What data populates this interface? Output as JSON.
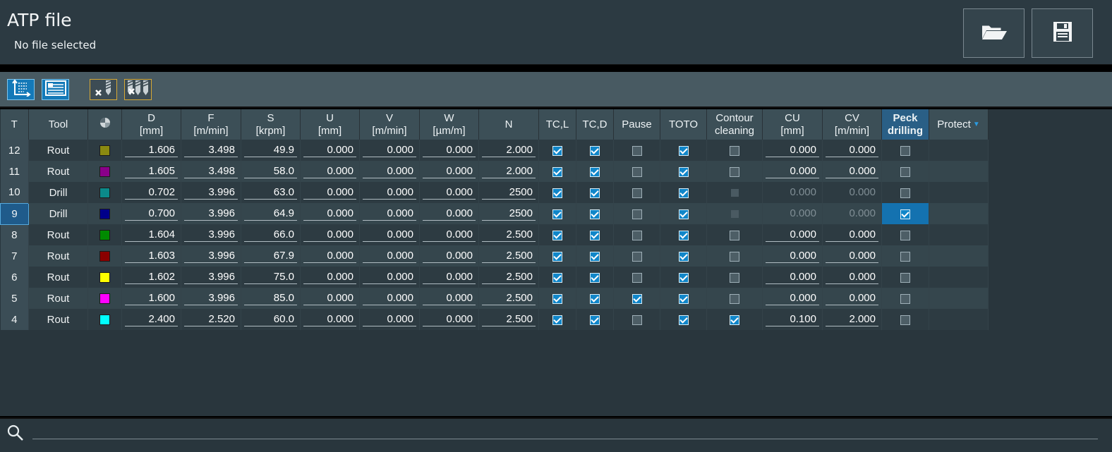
{
  "header": {
    "title": "ATP file",
    "subtitle": "No file selected"
  },
  "header_buttons": [
    {
      "name": "open-folder-button",
      "icon": "folder-open-icon"
    },
    {
      "name": "save-button",
      "icon": "floppy-disk-icon"
    }
  ],
  "toolbar": [
    {
      "name": "sort-axis-button",
      "icon": "axis-sort-icon"
    },
    {
      "name": "table-view-button",
      "icon": "table-view-icon"
    },
    {
      "name": "remove-tool-button",
      "icon": "remove-tool-icon"
    },
    {
      "name": "remove-all-tools-button",
      "icon": "remove-all-tools-icon"
    }
  ],
  "table": {
    "columns": [
      {
        "key": "t",
        "l1": "T",
        "l2": ""
      },
      {
        "key": "tool",
        "l1": "Tool",
        "l2": ""
      },
      {
        "key": "color",
        "l1": "",
        "l2": ""
      },
      {
        "key": "d",
        "l1": "D",
        "l2": "[mm]"
      },
      {
        "key": "f",
        "l1": "F",
        "l2": "[m/min]"
      },
      {
        "key": "s",
        "l1": "S",
        "l2": "[krpm]"
      },
      {
        "key": "u",
        "l1": "U",
        "l2": "[mm]"
      },
      {
        "key": "v",
        "l1": "V",
        "l2": "[m/min]"
      },
      {
        "key": "w",
        "l1": "W",
        "l2": "[µm/m]"
      },
      {
        "key": "n",
        "l1": "N",
        "l2": ""
      },
      {
        "key": "tcl",
        "l1": "TC,L",
        "l2": ""
      },
      {
        "key": "tcd",
        "l1": "TC,D",
        "l2": ""
      },
      {
        "key": "pause",
        "l1": "Pause",
        "l2": ""
      },
      {
        "key": "toto",
        "l1": "TOTO",
        "l2": ""
      },
      {
        "key": "contour",
        "l1": "Contour",
        "l2": "cleaning"
      },
      {
        "key": "cu",
        "l1": "CU",
        "l2": "[mm]"
      },
      {
        "key": "cv",
        "l1": "CV",
        "l2": "[m/min]"
      },
      {
        "key": "peck",
        "l1": "Peck",
        "l2": "drilling"
      },
      {
        "key": "protect",
        "l1": "Protect",
        "l2": ""
      }
    ],
    "selected_row": "9",
    "sort_indicator": "▼",
    "rows": [
      {
        "t": "12",
        "tool": "Rout",
        "color": "#8a8a10",
        "d": "1.606",
        "f": "3.498",
        "s": "49.9",
        "u": "0.000",
        "v": "0.000",
        "w": "0.000",
        "n": "2.000",
        "tcl": true,
        "tcd": true,
        "pause": false,
        "toto": true,
        "contour": false,
        "contour_disabled": false,
        "cu": "0.000",
        "cv": "0.000",
        "cu_dim": false,
        "peck": false
      },
      {
        "t": "11",
        "tool": "Rout",
        "color": "#8a008a",
        "d": "1.605",
        "f": "3.498",
        "s": "58.0",
        "u": "0.000",
        "v": "0.000",
        "w": "0.000",
        "n": "2.000",
        "tcl": true,
        "tcd": true,
        "pause": false,
        "toto": true,
        "contour": false,
        "contour_disabled": false,
        "cu": "0.000",
        "cv": "0.000",
        "cu_dim": false,
        "peck": false
      },
      {
        "t": "10",
        "tool": "Drill",
        "color": "#0b8a8a",
        "d": "0.702",
        "f": "3.996",
        "s": "63.0",
        "u": "0.000",
        "v": "0.000",
        "w": "0.000",
        "n": "2500",
        "tcl": true,
        "tcd": true,
        "pause": false,
        "toto": true,
        "contour": false,
        "contour_disabled": true,
        "cu": "0.000",
        "cv": "0.000",
        "cu_dim": true,
        "peck": false
      },
      {
        "t": "9",
        "tool": "Drill",
        "color": "#00008a",
        "d": "0.700",
        "f": "3.996",
        "s": "64.9",
        "u": "0.000",
        "v": "0.000",
        "w": "0.000",
        "n": "2500",
        "tcl": true,
        "tcd": true,
        "pause": false,
        "toto": true,
        "contour": false,
        "contour_disabled": true,
        "cu": "0.000",
        "cv": "0.000",
        "cu_dim": true,
        "peck": true
      },
      {
        "t": "8",
        "tool": "Rout",
        "color": "#008a00",
        "d": "1.604",
        "f": "3.996",
        "s": "66.0",
        "u": "0.000",
        "v": "0.000",
        "w": "0.000",
        "n": "2.500",
        "tcl": true,
        "tcd": true,
        "pause": false,
        "toto": true,
        "contour": false,
        "contour_disabled": false,
        "cu": "0.000",
        "cv": "0.000",
        "cu_dim": false,
        "peck": false
      },
      {
        "t": "7",
        "tool": "Rout",
        "color": "#8a0000",
        "d": "1.603",
        "f": "3.996",
        "s": "67.9",
        "u": "0.000",
        "v": "0.000",
        "w": "0.000",
        "n": "2.500",
        "tcl": true,
        "tcd": true,
        "pause": false,
        "toto": true,
        "contour": false,
        "contour_disabled": false,
        "cu": "0.000",
        "cv": "0.000",
        "cu_dim": false,
        "peck": false
      },
      {
        "t": "6",
        "tool": "Rout",
        "color": "#ffff00",
        "d": "1.602",
        "f": "3.996",
        "s": "75.0",
        "u": "0.000",
        "v": "0.000",
        "w": "0.000",
        "n": "2.500",
        "tcl": true,
        "tcd": true,
        "pause": false,
        "toto": true,
        "contour": false,
        "contour_disabled": false,
        "cu": "0.000",
        "cv": "0.000",
        "cu_dim": false,
        "peck": false
      },
      {
        "t": "5",
        "tool": "Rout",
        "color": "#ff00ff",
        "d": "1.600",
        "f": "3.996",
        "s": "85.0",
        "u": "0.000",
        "v": "0.000",
        "w": "0.000",
        "n": "2.500",
        "tcl": true,
        "tcd": true,
        "pause": true,
        "toto": true,
        "contour": false,
        "contour_disabled": false,
        "cu": "0.000",
        "cv": "0.000",
        "cu_dim": false,
        "peck": false
      },
      {
        "t": "4",
        "tool": "Rout",
        "color": "#00ffff",
        "d": "2.400",
        "f": "2.520",
        "s": "60.0",
        "u": "0.000",
        "v": "0.000",
        "w": "0.000",
        "n": "2.500",
        "tcl": true,
        "tcd": true,
        "pause": false,
        "toto": true,
        "contour": true,
        "contour_disabled": false,
        "cu": "0.100",
        "cv": "2.000",
        "cu_dim": false,
        "peck": false
      }
    ]
  },
  "search": {
    "placeholder": ""
  }
}
